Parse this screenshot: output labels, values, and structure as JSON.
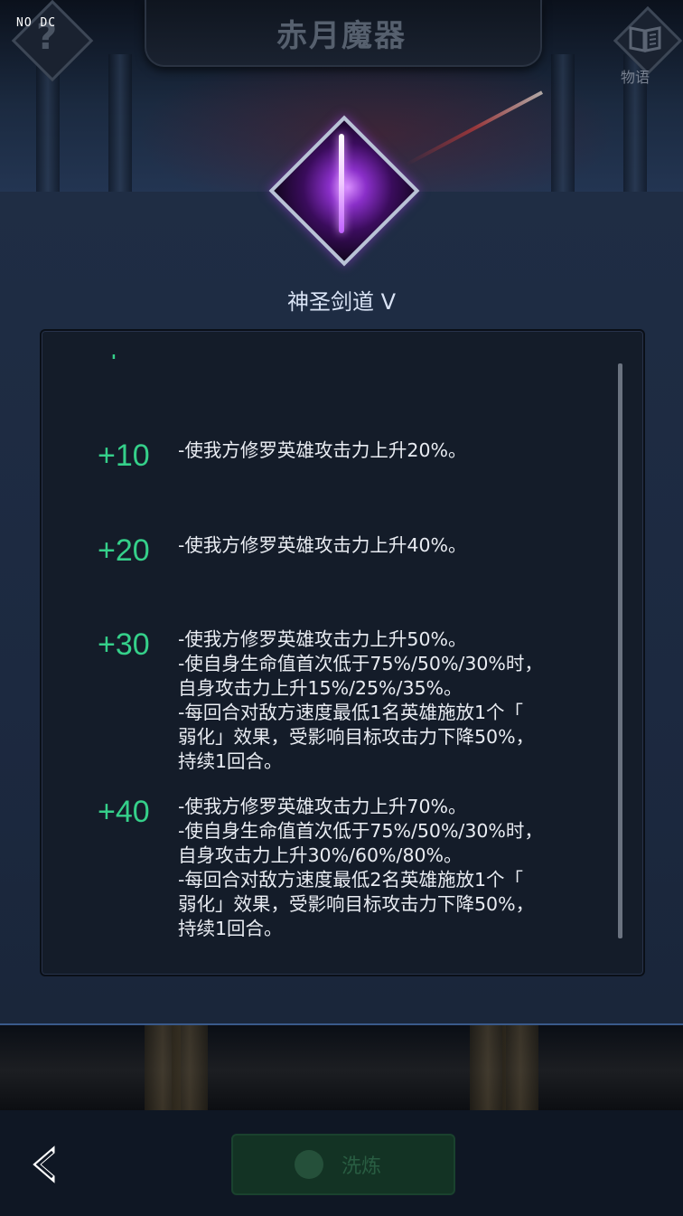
{
  "debug_tag": "NO DC",
  "header": {
    "title": "赤月魔器",
    "help_label": "?",
    "story_label": "物语"
  },
  "skill": {
    "name": "神圣剑道 V",
    "icon": "sword-skill-icon"
  },
  "levels": [
    {
      "level": "+10",
      "text": "-使我方修罗英雄攻击力上升20%。"
    },
    {
      "level": "+20",
      "text": "-使我方修罗英雄攻击力上升40%。"
    },
    {
      "level": "+30",
      "text": "-使我方修罗英雄攻击力上升50%。\n-使自身生命值首次低于75%/50%/30%时，\n自身攻击力上升15%/25%/35%。\n-每回合对敌方速度最低1名英雄施放1个「\n弱化」效果，受影响目标攻击力下降50%，\n持续1回合。"
    },
    {
      "level": "+40",
      "text": "-使我方修罗英雄攻击力上升70%。\n-使自身生命值首次低于75%/50%/30%时，\n自身攻击力上升30%/60%/80%。\n-每回合对敌方速度最低2名英雄施放1个「\n弱化」效果，受影响目标攻击力下降50%，\n持续1回合。"
    }
  ],
  "footer": {
    "wash_label": "洗炼",
    "back_icon": "back-arrow-icon"
  },
  "colors": {
    "level_green": "#35d08a",
    "title_gray": "#56606e"
  }
}
